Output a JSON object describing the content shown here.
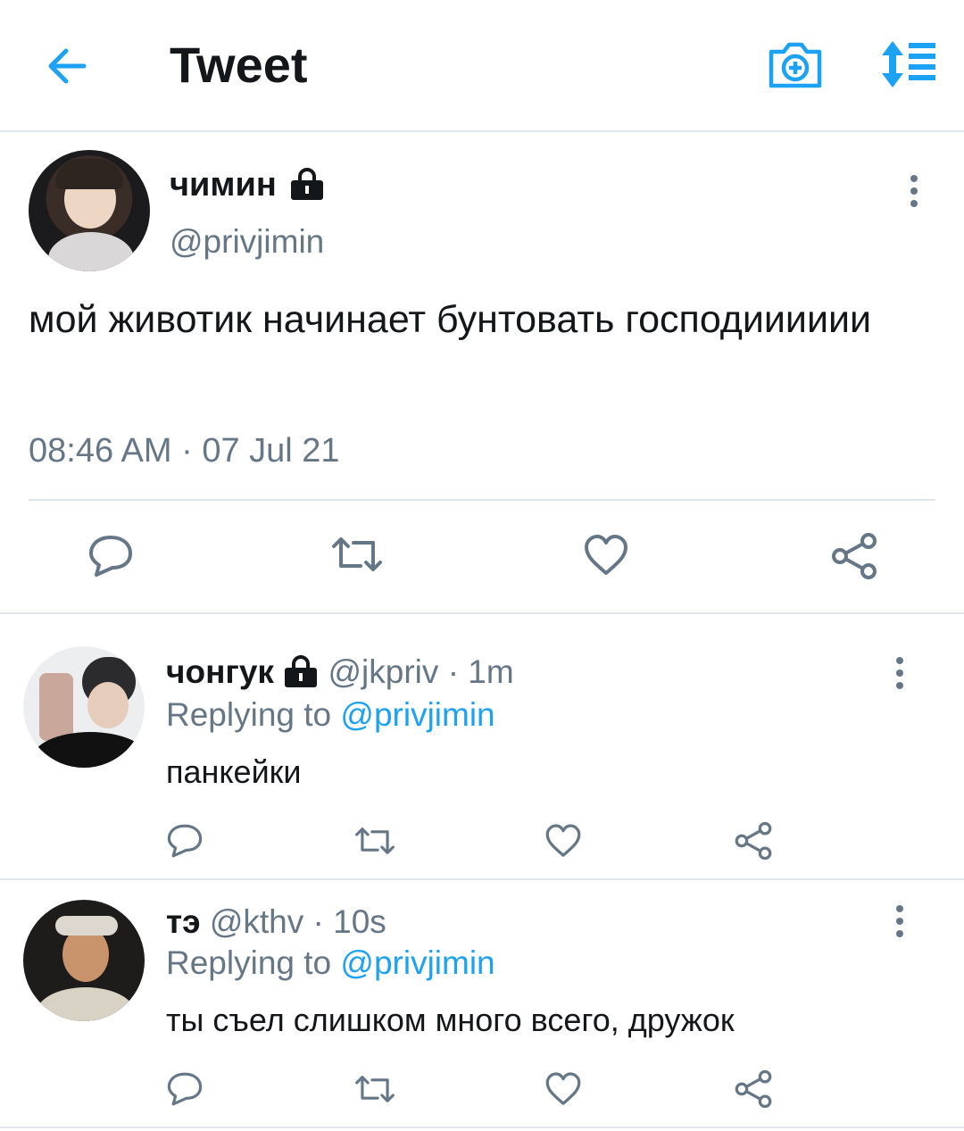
{
  "header": {
    "title": "Tweet",
    "back_icon": "back-arrow-icon",
    "camera_icon": "camera-icon",
    "sort_icon": "sort-icon",
    "accent": "#1da1f2"
  },
  "main_tweet": {
    "name": "чимин",
    "handle": "@privjimin",
    "text": "мой животик начинает бунтовать господииииии",
    "timestamp": "08:46 AM · 07 Jul 21"
  },
  "replies": [
    {
      "name": "чонгук",
      "handle": "@jkpriv",
      "time": "· 1m",
      "replying_prefix": "Replying to",
      "replying_to": "@privjimin",
      "text": "панкейки"
    },
    {
      "name": "тэ",
      "handle": "@kthv",
      "time": "· 10s",
      "replying_prefix": "Replying to",
      "replying_to": "@privjimin",
      "text": "ты съел слишком много всего, дружок"
    }
  ]
}
